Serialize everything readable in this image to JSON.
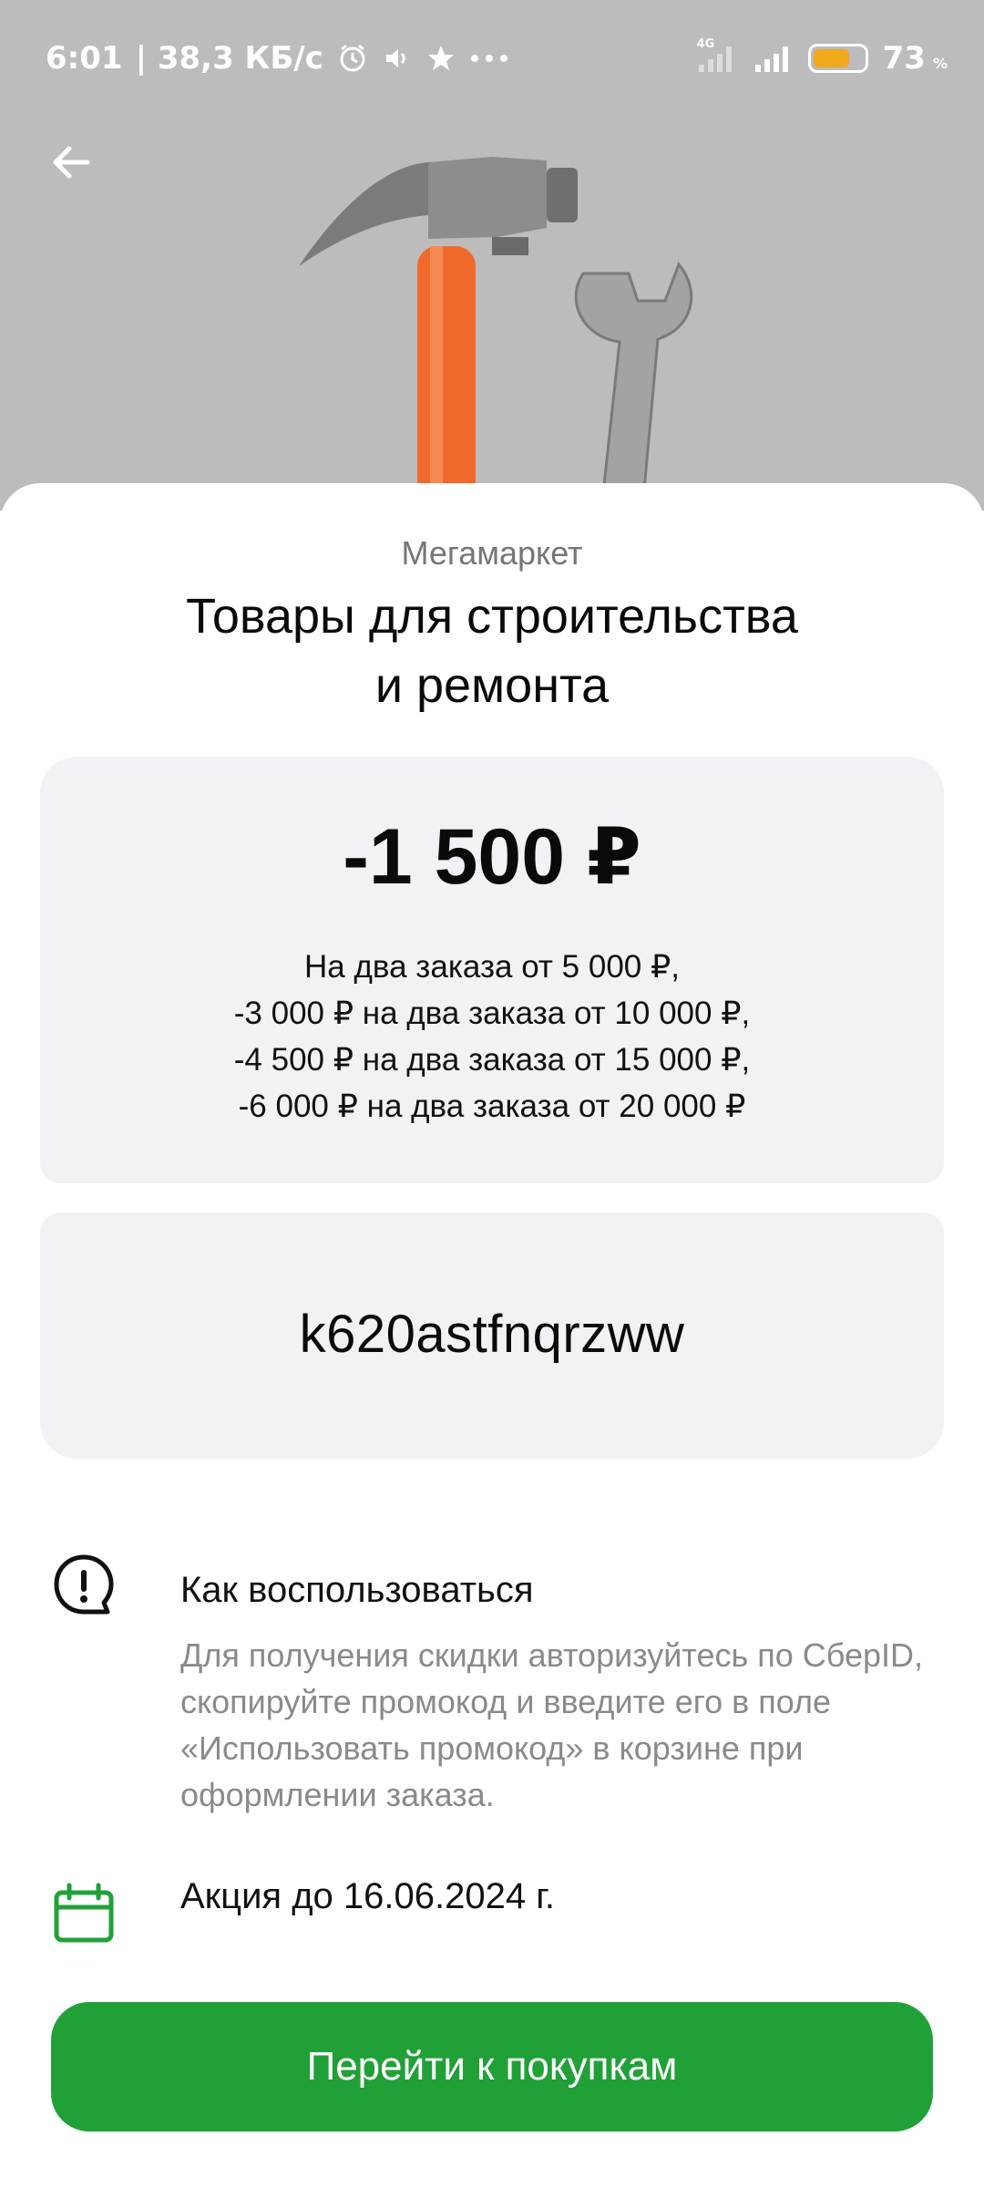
{
  "status_bar": {
    "time": "6:01",
    "speed": "| 38,3 КБ/с",
    "network_label": "4G",
    "battery_percent": "73",
    "battery_level": 0.73,
    "battery_fill_color": "#f2a81d",
    "icons": [
      "alarm-icon",
      "volume-icon",
      "star-icon",
      "more-icon",
      "signal-4g-icon",
      "signal-icon",
      "battery-icon"
    ]
  },
  "header": {
    "back_icon": "arrow-left-icon"
  },
  "offer": {
    "brand": "Мегамаркет",
    "title_line1": "Товары для строительства",
    "title_line2": "и ремонта",
    "amount": "-1 500 ₽",
    "terms": [
      "На два заказа от 5 000 ₽,",
      "-3 000 ₽ на два заказа от 10 000 ₽,",
      "-4 500 ₽ на два заказа от 15 000 ₽,",
      "-6 000 ₽ на два заказа от 20 000 ₽"
    ],
    "promo_code": "k620astfnqrzww"
  },
  "how_to": {
    "icon": "exclamation-bubble-icon",
    "title": "Как воспользоваться",
    "text": "Для получения скидки авторизуйтесь по СберID, скопируйте промокод и введите его в поле «Использовать промокод» в корзине при оформлении заказа."
  },
  "validity": {
    "icon": "calendar-icon",
    "title": "Акция до 16.06.2024 г."
  },
  "cta": {
    "label": "Перейти к покупкам"
  },
  "colors": {
    "accent": "#21a038",
    "hero_bg": "#bcbcbc",
    "coupon_bg": "#f0f2f5"
  }
}
